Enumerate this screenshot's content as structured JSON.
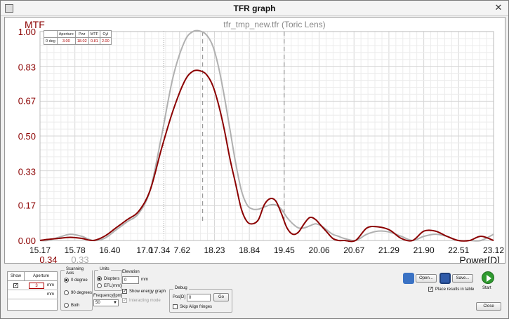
{
  "window": {
    "title": "TFR graph",
    "close_glyph": "✕"
  },
  "graph": {
    "subtitle": "tfr_tmp_new.tfr (Toric Lens)",
    "y_title": "MTF",
    "x_title": "Power[D]",
    "y_ticks": [
      "1.00",
      "0.83",
      "0.67",
      "0.50",
      "0.33",
      "0.17",
      "0.00"
    ],
    "x_ticks": [
      "15.17",
      "15.78",
      "16.40",
      "17.0",
      "17.34",
      "7.62",
      "18.23",
      "18.84",
      "19.45",
      "20.06",
      "20.67",
      "21.29",
      "21.90",
      "22.51",
      "23.12"
    ],
    "secondary_labels": {
      "red": "0.34",
      "gray": "0.33"
    }
  },
  "mtf_table": {
    "headers": [
      "",
      "Aperture",
      "Pwr",
      "MTF",
      "Cyl"
    ],
    "row": [
      "0 deg",
      "3.00",
      "18.02",
      "0.81",
      "2.00"
    ]
  },
  "chart_data": {
    "type": "line",
    "title": "tfr_tmp_new.tfr (Toric Lens)",
    "xlabel": "Power[D]",
    "ylabel": "MTF",
    "xlim": [
      15.17,
      23.12
    ],
    "ylim": [
      0,
      1.0
    ],
    "grid": true,
    "colors": {
      "red_series": "#8b0000",
      "gray_series": "#b0b0b0",
      "markers": "#999999"
    },
    "vlines_dashed": [
      18.02,
      19.45
    ],
    "vline_dotted": 17.34,
    "series": [
      {
        "color": "red",
        "x": [
          15.17,
          15.3,
          15.5,
          15.7,
          15.9,
          16.1,
          16.3,
          16.5,
          16.7,
          16.9,
          17.1,
          17.3,
          17.5,
          17.7,
          17.85,
          18.0,
          18.1,
          18.2,
          18.3,
          18.4,
          18.5,
          18.6,
          18.7,
          18.8,
          18.9,
          19.0,
          19.1,
          19.2,
          19.3,
          19.4,
          19.5,
          19.6,
          19.7,
          19.8,
          19.9,
          20.0,
          20.1,
          20.2,
          20.3,
          20.4,
          20.5,
          20.7,
          20.9,
          21.1,
          21.3,
          21.5,
          21.7,
          21.9,
          22.1,
          22.3,
          22.5,
          22.7,
          22.9,
          23.12
        ],
        "y": [
          0.0,
          0.005,
          0.01,
          0.015,
          0.01,
          0.0,
          0.02,
          0.06,
          0.1,
          0.14,
          0.24,
          0.44,
          0.62,
          0.76,
          0.81,
          0.81,
          0.79,
          0.74,
          0.65,
          0.53,
          0.39,
          0.27,
          0.15,
          0.09,
          0.08,
          0.1,
          0.17,
          0.2,
          0.19,
          0.13,
          0.06,
          0.03,
          0.04,
          0.08,
          0.11,
          0.1,
          0.07,
          0.04,
          0.01,
          0.0,
          0.0,
          0.0,
          0.06,
          0.065,
          0.05,
          0.01,
          0.0,
          0.045,
          0.045,
          0.02,
          0.0,
          0.0,
          0.02,
          0.0
        ]
      },
      {
        "color": "gray",
        "x": [
          15.17,
          15.3,
          15.5,
          15.7,
          15.9,
          16.1,
          16.3,
          16.5,
          16.7,
          16.9,
          17.1,
          17.3,
          17.5,
          17.7,
          17.85,
          18.0,
          18.1,
          18.2,
          18.3,
          18.4,
          18.5,
          18.6,
          18.7,
          18.8,
          18.9,
          19.0,
          19.1,
          19.2,
          19.3,
          19.4,
          19.5,
          19.6,
          19.7,
          19.8,
          19.9,
          20.0,
          20.1,
          20.2,
          20.3,
          20.4,
          20.5,
          20.7,
          20.9,
          21.1,
          21.3,
          21.5,
          21.7,
          21.9,
          22.1,
          22.3,
          22.5,
          22.7,
          22.9,
          23.12
        ],
        "y": [
          0.0,
          0.0,
          0.015,
          0.03,
          0.02,
          0.0,
          0.01,
          0.05,
          0.09,
          0.13,
          0.24,
          0.5,
          0.78,
          0.95,
          1.0,
          1.0,
          0.98,
          0.93,
          0.83,
          0.69,
          0.53,
          0.37,
          0.24,
          0.17,
          0.15,
          0.15,
          0.16,
          0.17,
          0.17,
          0.15,
          0.11,
          0.08,
          0.06,
          0.06,
          0.07,
          0.08,
          0.07,
          0.05,
          0.03,
          0.02,
          0.01,
          0.0,
          0.03,
          0.045,
          0.04,
          0.02,
          0.0,
          0.02,
          0.03,
          0.02,
          0.0,
          0.0,
          0.0,
          0.03
        ]
      }
    ]
  },
  "controls": {
    "show_header": "Show",
    "aperture_header": "Aperture",
    "aperture_value": "3",
    "aperture_unit": "mm",
    "aperture_unit_2": "mm",
    "scanning_axis": {
      "title": "Scanning Axis",
      "options": [
        "0 degree",
        "90 degrees",
        "Both"
      ]
    },
    "units": {
      "title": "Units",
      "options": [
        "Diopters",
        "EFL(mm)"
      ]
    },
    "frequency_label": "Frequency[lpm]",
    "frequency_value": "50",
    "elevation_label": "Elevation",
    "elevation_value": "0",
    "elevation_unit": "mm",
    "show_energy": "Show energy graph",
    "interacting": "Interacting mode",
    "debug": {
      "title": "Debug",
      "pos_label": "Pos[D]",
      "pos_value": "0",
      "go": "Go",
      "skip": "Skip Align fringes"
    },
    "open": "Open...",
    "save": "Save...",
    "start": "Start",
    "place_results": "Place results in table",
    "close": "Close"
  }
}
